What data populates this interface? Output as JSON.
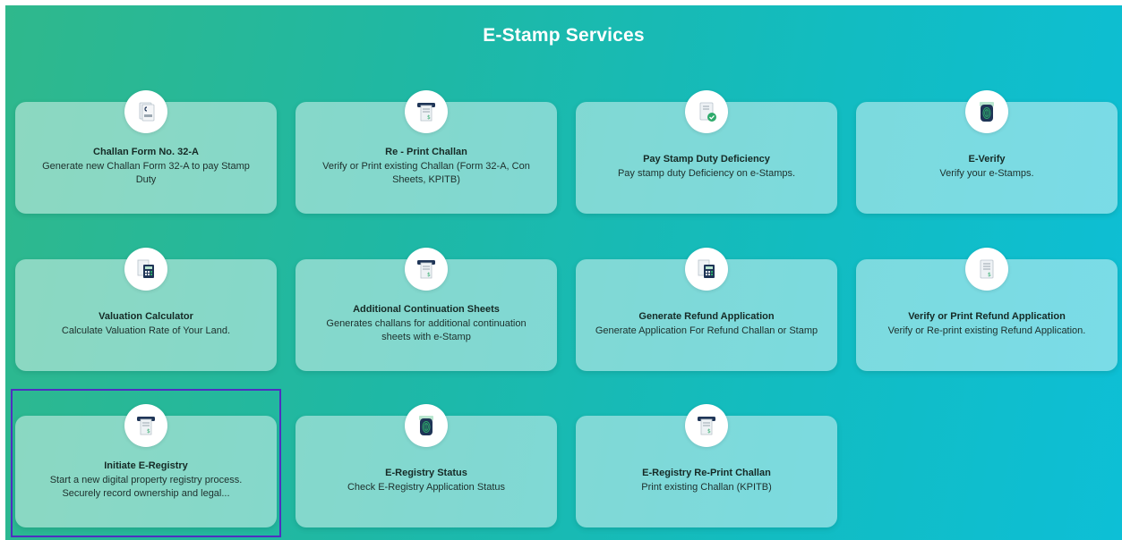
{
  "header": {
    "title": "E-Stamp Services"
  },
  "cards": [
    {
      "title": "Challan Form No. 32-A",
      "description": "Generate new Challan Form 32-A to pay Stamp Duty",
      "icon": "receipt-icon"
    },
    {
      "title": "Re - Print Challan",
      "description": "Verify or Print existing Challan (Form 32-A, Con Sheets, KPITB)",
      "icon": "printer-receipt-icon"
    },
    {
      "title": "Pay Stamp Duty Deficiency",
      "description": "Pay stamp duty Deficiency on e-Stamps.",
      "icon": "document-check-icon"
    },
    {
      "title": "E-Verify",
      "description": "Verify your e-Stamps.",
      "icon": "fingerprint-icon"
    },
    {
      "title": "Valuation Calculator",
      "description": "Calculate Valuation Rate of Your Land.",
      "icon": "calculator-icon"
    },
    {
      "title": "Additional Continuation Sheets",
      "description": "Generates challans for additional continuation sheets with e-Stamp",
      "icon": "printer-receipt-icon"
    },
    {
      "title": "Generate Refund Application",
      "description": "Generate Application For Refund Challan or Stamp",
      "icon": "calculator-icon"
    },
    {
      "title": "Verify or Print Refund Application",
      "description": "Verify or Re-print existing Refund Application.",
      "icon": "document-icon"
    },
    {
      "title": "Initiate E-Registry",
      "description": "Start a new digital property registry process. Securely record ownership and legal...",
      "icon": "printer-receipt-icon"
    },
    {
      "title": "E-Registry Status",
      "description": "Check E-Registry Application Status",
      "icon": "fingerprint-icon"
    },
    {
      "title": "E-Registry Re-Print Challan",
      "description": "Print existing Challan (KPITB)",
      "icon": "printer-receipt-icon"
    }
  ],
  "colors": {
    "gradient_start": "#2fb88c",
    "gradient_end": "#0dbfd6",
    "highlight_border": "#4f2fc0",
    "icon_navy": "#1f3557",
    "icon_green": "#2eaa6b"
  }
}
